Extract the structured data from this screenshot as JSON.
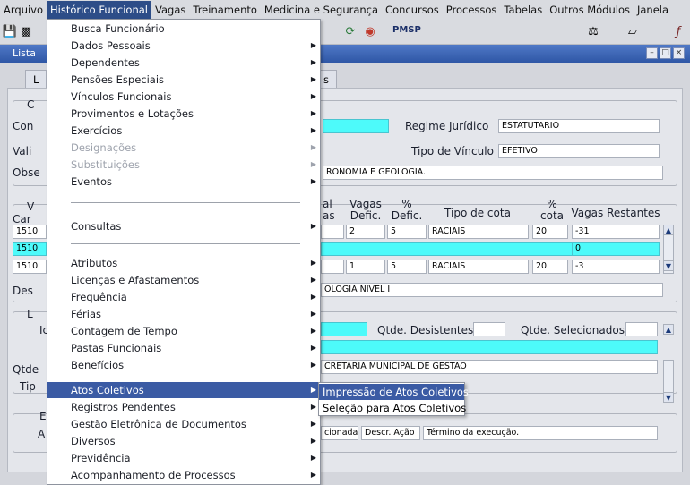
{
  "menubar": {
    "items": [
      "Arquivo",
      "Histórico Funcional",
      "Vagas",
      "Treinamento",
      "Medicina e Segurança",
      "Concursos",
      "Processos",
      "Tabelas",
      "Outros Módulos",
      "Janela"
    ],
    "active_index": 1
  },
  "toolbar": {
    "brand": "PMSP",
    "icons": [
      "save-icon",
      "print-icon",
      "refresh-icon",
      "system-icon",
      "balance-icon",
      "image-icon",
      "function-icon"
    ]
  },
  "window": {
    "title": "Lista"
  },
  "tabs": [
    "L",
    "s"
  ],
  "form": {
    "section_c": "C",
    "label_con": "Con",
    "label_vali": "Vali",
    "label_obse": "Obse",
    "regime_label": "Regime Jurídico",
    "regime_value": "ESTATUTARIO",
    "vinculo_label": "Tipo de Vínculo",
    "vinculo_value": "EFETIVO",
    "obs_value": "RONOMIA E GEOLOGIA.",
    "section_v": "V",
    "label_car": "Car",
    "headers": [
      "al\nas",
      "Vagas\nDefic.",
      "%\nDefic.",
      "Tipo de cota",
      "%\ncota",
      "Vagas Restantes"
    ],
    "rows": [
      {
        "code": "1510",
        "vagas": "2",
        "defic": "5",
        "tipo": "RACIAIS",
        "cota": "20",
        "rest": "-31"
      },
      {
        "code": "1510",
        "vagas": "",
        "defic": "",
        "tipo": "",
        "cota": "",
        "rest": "0"
      },
      {
        "code": "1510",
        "vagas": "1",
        "defic": "5",
        "tipo": "RACIAIS",
        "cota": "20",
        "rest": "-3"
      }
    ],
    "label_des": "Des",
    "des_value": "OLOGIA NIVEL I",
    "section_l": "L",
    "label_ic": "Ic",
    "desistentes_label": "Qtde. Desistentes",
    "selecionados_label": "Qtde. Selecionados",
    "label_qtde": "Qtde",
    "orgao_value": "CRETARIA MUNICIPAL DE GESTAO",
    "label_tip": "Tip",
    "section_e": "E",
    "label_a": "A",
    "acao_col1": "cionada",
    "acao_col2": "Descr. Ação",
    "acao_col3": "Término da execução."
  },
  "dropdown": {
    "items": [
      {
        "label": "Busca Funcionário",
        "arrow": false
      },
      {
        "label": "Dados Pessoais",
        "arrow": true
      },
      {
        "label": "Dependentes",
        "arrow": true
      },
      {
        "label": "Pensões Especiais",
        "arrow": true
      },
      {
        "label": "Vínculos Funcionais",
        "arrow": true
      },
      {
        "label": "Provimentos e Lotações",
        "arrow": true
      },
      {
        "label": "Exercícios",
        "arrow": true
      },
      {
        "label": "Designações",
        "arrow": true,
        "disabled": true
      },
      {
        "label": "Substituições",
        "arrow": true,
        "disabled": true
      },
      {
        "label": "Eventos",
        "arrow": true
      },
      {
        "label": "Consultas",
        "arrow": true
      },
      {
        "label": "Atributos",
        "arrow": true
      },
      {
        "label": "Licenças e Afastamentos",
        "arrow": true
      },
      {
        "label": "Frequência",
        "arrow": true
      },
      {
        "label": "Férias",
        "arrow": true
      },
      {
        "label": "Contagem de Tempo",
        "arrow": true
      },
      {
        "label": "Pastas Funcionais",
        "arrow": true
      },
      {
        "label": "Benefícios",
        "arrow": true
      },
      {
        "label": "Atos Coletivos",
        "arrow": true,
        "highlighted": true
      },
      {
        "label": "Registros Pendentes",
        "arrow": true
      },
      {
        "label": "Gestão Eletrônica de Documentos",
        "arrow": true
      },
      {
        "label": "Diversos",
        "arrow": true
      },
      {
        "label": "Previdência",
        "arrow": true
      },
      {
        "label": "Acompanhamento de Processos",
        "arrow": true
      }
    ]
  },
  "submenu": {
    "items": [
      {
        "label": "Impressão de Atos Coletivos",
        "highlighted": true
      },
      {
        "label": "Seleção para Atos Coletivos"
      }
    ]
  },
  "colors": {
    "highlight": "#3b5ba4",
    "cyan_field": "#4dfafa",
    "title_bar": "#2f57a6"
  }
}
